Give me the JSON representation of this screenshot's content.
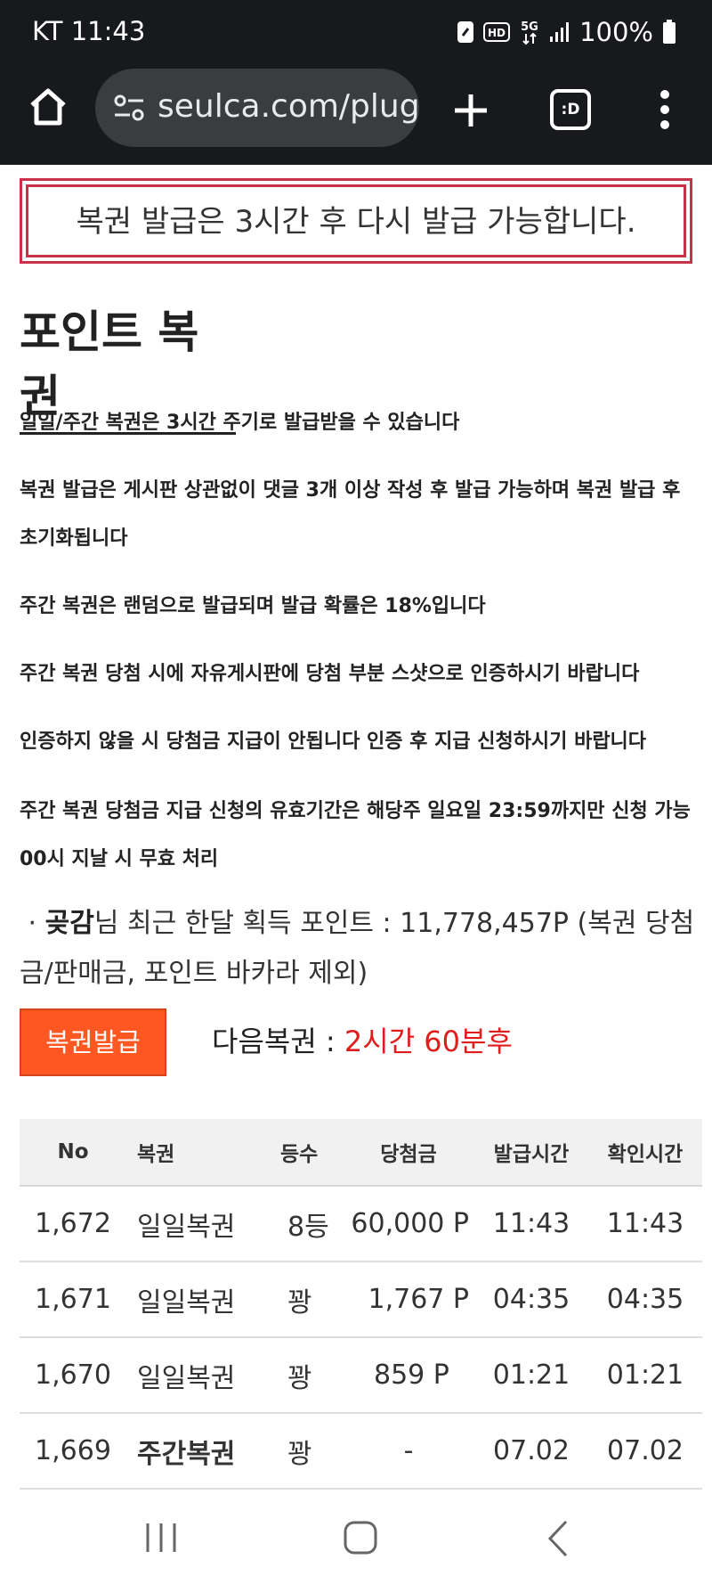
{
  "status": {
    "time": "KT 11:43",
    "battery": "100%",
    "icons": [
      "app-notification-icon",
      "hd-voice-icon",
      "5g-icon",
      "signal-icon",
      "battery-icon"
    ]
  },
  "browser": {
    "url": "seulca.com/plug",
    "tabs_label": ":D"
  },
  "notice": "복권 발급은 3시간 후 다시 발급 가능합니다.",
  "page_title": "포인트 복권",
  "rules": [
    "일일/주간 복권은 3시간 주기로 발급받을 수 있습니다",
    "복권 발급은 게시판 상관없이 댓글 3개 이상 작성 후 발급 가능하며 복권 발급 후 초기화됩니다",
    "주간 복권은 랜덤으로 발급되며 발급 확률은 18%입니다",
    "주간 복권 당첨 시에 자유게시판에 당첨 부분 스샷으로 인증하시기 바랍니다",
    "인증하지 않을 시 당첨금 지급이 안됩니다 인증 후 지급 신청하시기 바랍니다",
    "주간 복권 당첨금 지급 신청의 유효기간은 해당주 일요일 23:59까지만 신청 가능 00시 지날 시 무효 처리"
  ],
  "points": {
    "bullet": "·",
    "user": "곶감",
    "text": "님 최근 한달 획득 포인트 : 11,778,457P (복권 당첨금/판매금, 포인트 바카라 제외)"
  },
  "issue_button": "복권발급",
  "next": {
    "label": "다음복권 : ",
    "value": "2시간 60분후"
  },
  "table": {
    "headers": [
      "No",
      "복권",
      "등수",
      "당첨금",
      "발급시간",
      "확인시간"
    ],
    "rows": [
      {
        "no": "1,672",
        "name": "일일복권",
        "rank": "8등",
        "prize": "60,000 P",
        "issued": "11:43",
        "checked": "11:43"
      },
      {
        "no": "1,671",
        "name": "일일복권",
        "rank": "꽝",
        "prize": "1,767 P",
        "issued": "04:35",
        "checked": "04:35"
      },
      {
        "no": "1,670",
        "name": "일일복권",
        "rank": "꽝",
        "prize": "859 P",
        "issued": "01:21",
        "checked": "01:21"
      },
      {
        "no": "1,669",
        "name": "주간복권",
        "rank": "꽝",
        "prize": "-",
        "issued": "07.02",
        "checked": "07.02"
      }
    ]
  },
  "colors": {
    "accent_button": "#ff5722",
    "notice_border": "#c9334a",
    "next_value": "#e01c1c",
    "topbar": "#17191c"
  }
}
